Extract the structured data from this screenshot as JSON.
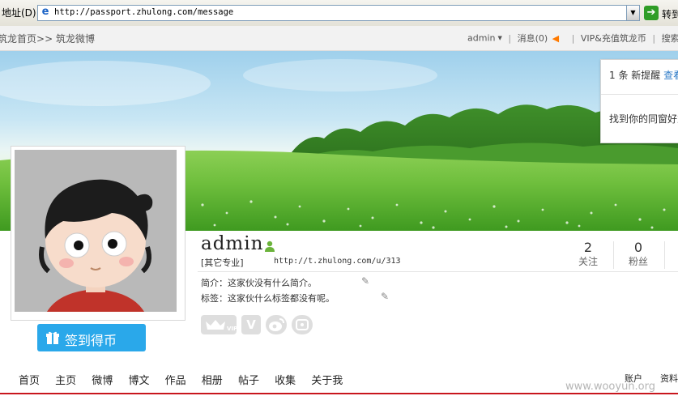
{
  "browser": {
    "address_label": "地址(D)",
    "url": "http://passport.zhulong.com/message",
    "go_label": "转到"
  },
  "site_nav": {
    "breadcrumb": [
      "筑龙首页",
      "筑龙微博"
    ],
    "breadcrumb_separator": ">>",
    "user_menu": "admin",
    "messages": "消息(0)",
    "vip": "VIP&充值筑龙币",
    "search": "搜索"
  },
  "notifications": {
    "count_text": "1 条 新提醒",
    "view_link": "查看",
    "find_classmates": "找到你的同窗好友"
  },
  "profile": {
    "username": "admin",
    "major": "[其它专业]",
    "url": "http://t.zhulong.com/u/313",
    "stats": [
      {
        "num": "2",
        "label": "关注"
      },
      {
        "num": "0",
        "label": "粉丝"
      }
    ],
    "intro_label": "简介：",
    "intro_text": "这家伙没有什么简介。",
    "tags_label": "标签：",
    "tags_text": "这家伙什么标签都没有呢。",
    "badges": [
      "VIP",
      "V",
      "weibo",
      "phone"
    ]
  },
  "checkin_button": "签到得币",
  "tabs": [
    "首页",
    "主页",
    "微博",
    "博文",
    "作品",
    "相册",
    "帖子",
    "收集",
    "关于我"
  ],
  "tab_account": "账户",
  "tab_resource": "资料",
  "watermark": "www.wooyun.org",
  "colors": {
    "accent_blue": "#2aa8ea",
    "link_blue": "#2e7bc7",
    "bottom_line_red": "#c8161d",
    "speaker_orange": "#ff7a00"
  }
}
